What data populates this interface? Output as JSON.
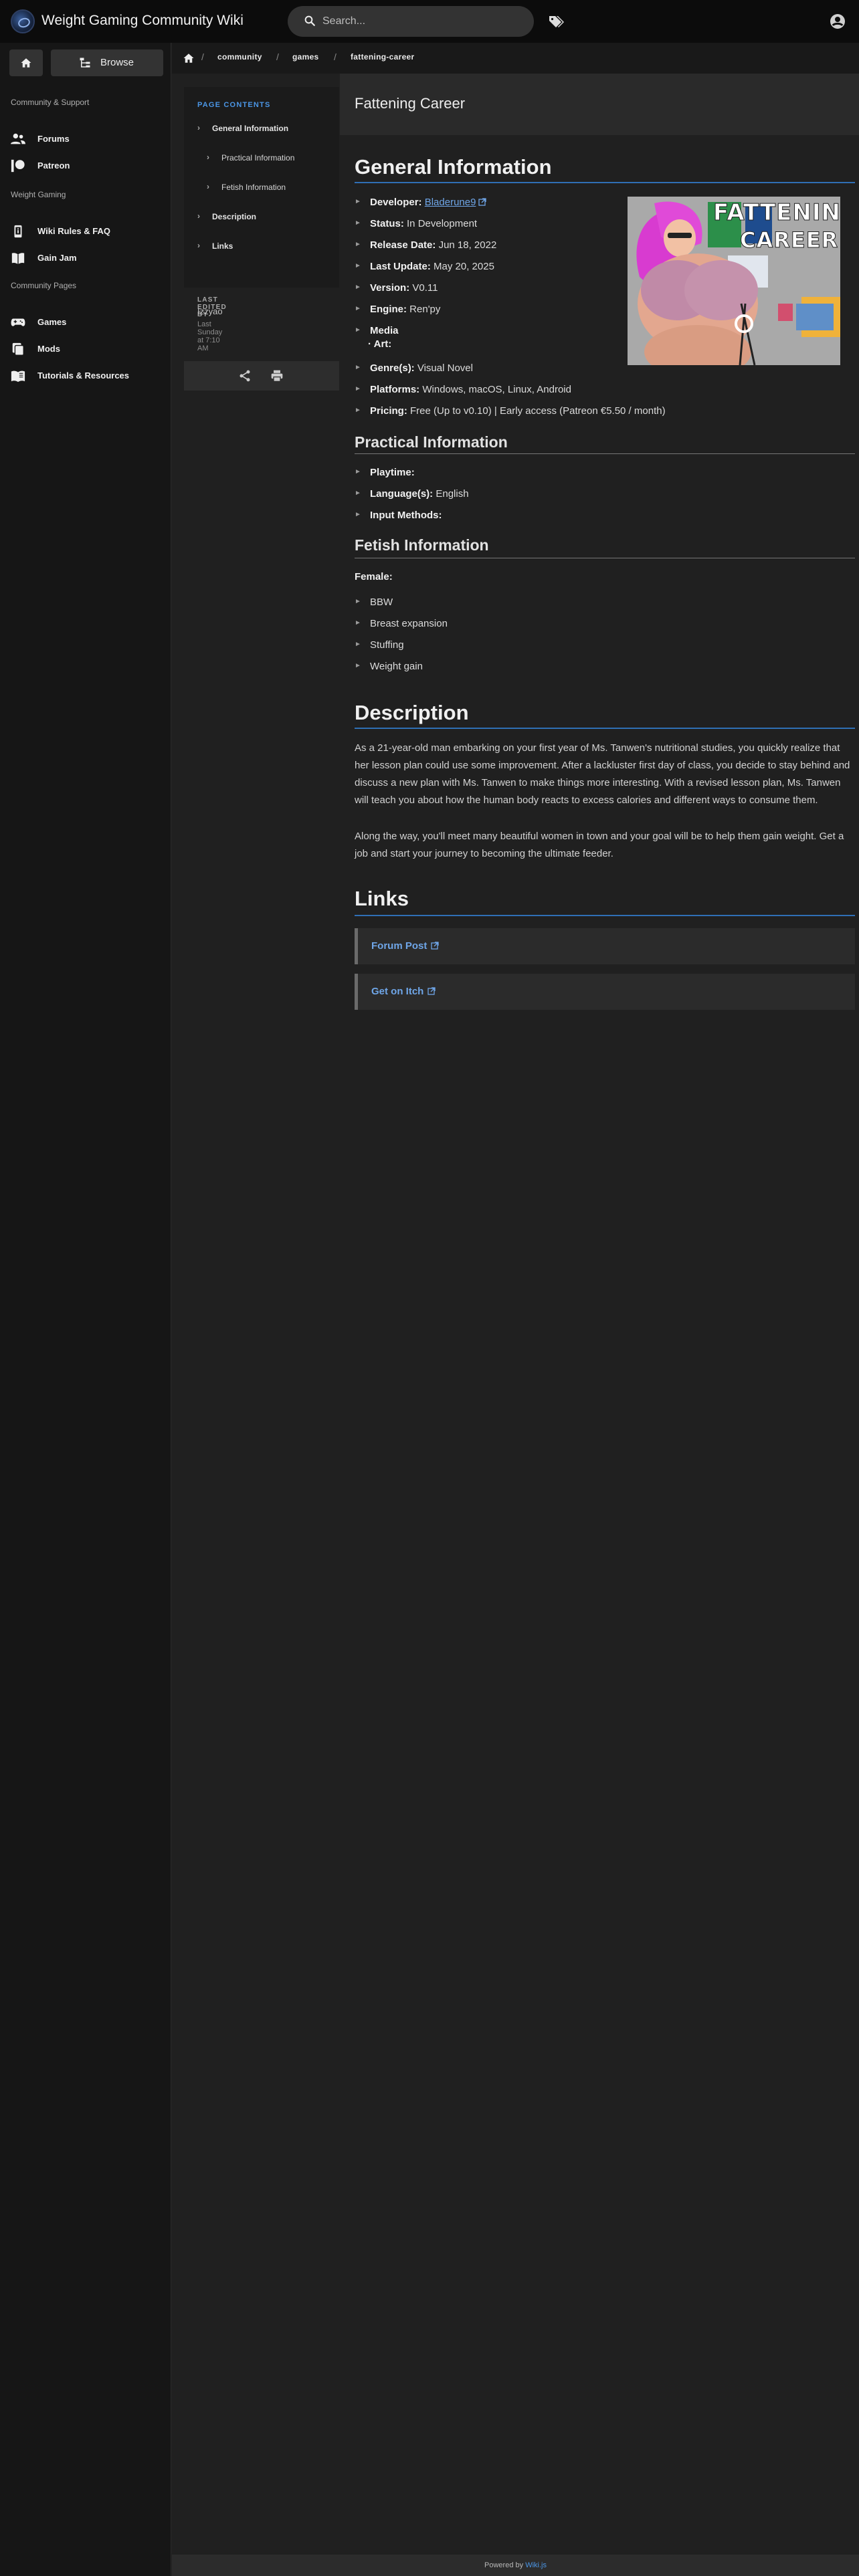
{
  "header": {
    "app_title": "Weight Gaming Community Wiki",
    "search_placeholder": "Search..."
  },
  "sidebar": {
    "browse_label": "Browse",
    "sections": [
      "Community & Support",
      "Weight Gaming",
      "Community Pages"
    ],
    "items": [
      {
        "label": "Forums",
        "icon": "people-icon"
      },
      {
        "label": "Patreon",
        "icon": "patreon-icon"
      },
      {
        "label": "Wiki Rules & FAQ",
        "icon": "phone-info-icon"
      },
      {
        "label": "Gain Jam",
        "icon": "book-icon"
      },
      {
        "label": "Games",
        "icon": "gamepad-icon"
      },
      {
        "label": "Mods",
        "icon": "mods-icon"
      },
      {
        "label": "Tutorials & Resources",
        "icon": "book-open-icon"
      }
    ]
  },
  "breadcrumb": {
    "items": [
      "community",
      "games",
      "fattening-career"
    ]
  },
  "toc": {
    "title": "PAGE CONTENTS",
    "items": [
      {
        "label": "General Information",
        "level": 1
      },
      {
        "label": "Practical Information",
        "level": 2
      },
      {
        "label": "Fetish Information",
        "level": 2
      },
      {
        "label": "Description",
        "level": 1
      },
      {
        "label": "Links",
        "level": 1
      }
    ],
    "last_edited_label": "LAST EDITED BY",
    "last_edited_user": "Izzyao",
    "last_edited_time": "Last Sunday at 7:10 AM"
  },
  "page": {
    "title": "Fattening Career",
    "general": {
      "heading": "General Information",
      "developer_label": "Developer:",
      "developer_value": "Bladerune9",
      "status_label": "Status:",
      "status_value": "In Development",
      "release_label": "Release Date:",
      "release_value": "Jun 18, 2022",
      "update_label": "Last Update:",
      "update_value": "May 20, 2025",
      "version_label": "Version:",
      "version_value": "V0.11",
      "engine_label": "Engine:",
      "engine_value": "Ren'py",
      "media_label": "Media",
      "art_label": "· Art:",
      "genre_label": "Genre(s):",
      "genre_value": "Visual Novel",
      "platforms_label": "Platforms:",
      "platforms_value": "Windows, macOS, Linux, Android",
      "pricing_label": "Pricing:",
      "pricing_value": "Free (Up to v0.10) | Early access (Patreon €5.50 / month)",
      "cover_text_1": "FATTENING",
      "cover_text_2": "CAREER"
    },
    "practical": {
      "heading": "Practical Information",
      "playtime_label": "Playtime:",
      "language_label": "Language(s):",
      "language_value": "English",
      "input_label": "Input Methods:"
    },
    "fetish": {
      "heading": "Fetish Information",
      "female_label": "Female:",
      "items": [
        "BBW",
        "Breast expansion",
        "Stuffing",
        "Weight gain"
      ]
    },
    "description": {
      "heading": "Description",
      "paragraph_1": "As a 21-year-old man embarking on your first year of Ms. Tanwen's nutritional studies, you quickly realize that her lesson plan could use some improvement. After a lackluster first day of class, you decide to stay behind and discuss a new plan with Ms. Tanwen to make things more interesting. With a revised lesson plan, Ms. Tanwen will teach you about how the human body reacts to excess calories and different ways to consume them.",
      "paragraph_2": "Along the way, you'll meet many beautiful women in town and your goal will be to help them gain weight. Get a job and start your journey to becoming the ultimate feeder."
    },
    "links": {
      "heading": "Links",
      "items": [
        "Forum Post",
        "Get on Itch"
      ]
    }
  },
  "footer": {
    "prefix": "Powered by",
    "link": "Wiki.js"
  },
  "colors": {
    "accent": "#4b96e6",
    "link": "#6fa6e8",
    "heading_rule": "#2f6fb5"
  }
}
